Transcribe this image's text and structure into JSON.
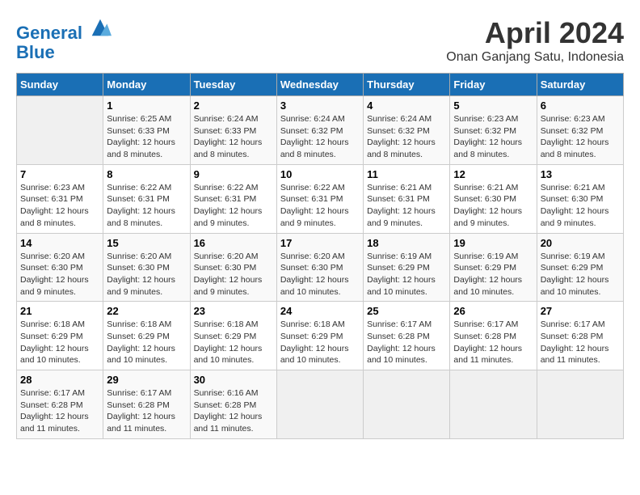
{
  "logo": {
    "line1": "General",
    "line2": "Blue"
  },
  "title": "April 2024",
  "subtitle": "Onan Ganjang Satu, Indonesia",
  "days_of_week": [
    "Sunday",
    "Monday",
    "Tuesday",
    "Wednesday",
    "Thursday",
    "Friday",
    "Saturday"
  ],
  "weeks": [
    [
      {
        "day": "",
        "empty": true
      },
      {
        "day": "1",
        "sunrise": "Sunrise: 6:25 AM",
        "sunset": "Sunset: 6:33 PM",
        "daylight": "Daylight: 12 hours and 8 minutes."
      },
      {
        "day": "2",
        "sunrise": "Sunrise: 6:24 AM",
        "sunset": "Sunset: 6:33 PM",
        "daylight": "Daylight: 12 hours and 8 minutes."
      },
      {
        "day": "3",
        "sunrise": "Sunrise: 6:24 AM",
        "sunset": "Sunset: 6:32 PM",
        "daylight": "Daylight: 12 hours and 8 minutes."
      },
      {
        "day": "4",
        "sunrise": "Sunrise: 6:24 AM",
        "sunset": "Sunset: 6:32 PM",
        "daylight": "Daylight: 12 hours and 8 minutes."
      },
      {
        "day": "5",
        "sunrise": "Sunrise: 6:23 AM",
        "sunset": "Sunset: 6:32 PM",
        "daylight": "Daylight: 12 hours and 8 minutes."
      },
      {
        "day": "6",
        "sunrise": "Sunrise: 6:23 AM",
        "sunset": "Sunset: 6:32 PM",
        "daylight": "Daylight: 12 hours and 8 minutes."
      }
    ],
    [
      {
        "day": "7",
        "sunrise": "Sunrise: 6:23 AM",
        "sunset": "Sunset: 6:31 PM",
        "daylight": "Daylight: 12 hours and 8 minutes."
      },
      {
        "day": "8",
        "sunrise": "Sunrise: 6:22 AM",
        "sunset": "Sunset: 6:31 PM",
        "daylight": "Daylight: 12 hours and 8 minutes."
      },
      {
        "day": "9",
        "sunrise": "Sunrise: 6:22 AM",
        "sunset": "Sunset: 6:31 PM",
        "daylight": "Daylight: 12 hours and 9 minutes."
      },
      {
        "day": "10",
        "sunrise": "Sunrise: 6:22 AM",
        "sunset": "Sunset: 6:31 PM",
        "daylight": "Daylight: 12 hours and 9 minutes."
      },
      {
        "day": "11",
        "sunrise": "Sunrise: 6:21 AM",
        "sunset": "Sunset: 6:31 PM",
        "daylight": "Daylight: 12 hours and 9 minutes."
      },
      {
        "day": "12",
        "sunrise": "Sunrise: 6:21 AM",
        "sunset": "Sunset: 6:30 PM",
        "daylight": "Daylight: 12 hours and 9 minutes."
      },
      {
        "day": "13",
        "sunrise": "Sunrise: 6:21 AM",
        "sunset": "Sunset: 6:30 PM",
        "daylight": "Daylight: 12 hours and 9 minutes."
      }
    ],
    [
      {
        "day": "14",
        "sunrise": "Sunrise: 6:20 AM",
        "sunset": "Sunset: 6:30 PM",
        "daylight": "Daylight: 12 hours and 9 minutes."
      },
      {
        "day": "15",
        "sunrise": "Sunrise: 6:20 AM",
        "sunset": "Sunset: 6:30 PM",
        "daylight": "Daylight: 12 hours and 9 minutes."
      },
      {
        "day": "16",
        "sunrise": "Sunrise: 6:20 AM",
        "sunset": "Sunset: 6:30 PM",
        "daylight": "Daylight: 12 hours and 9 minutes."
      },
      {
        "day": "17",
        "sunrise": "Sunrise: 6:20 AM",
        "sunset": "Sunset: 6:30 PM",
        "daylight": "Daylight: 12 hours and 10 minutes."
      },
      {
        "day": "18",
        "sunrise": "Sunrise: 6:19 AM",
        "sunset": "Sunset: 6:29 PM",
        "daylight": "Daylight: 12 hours and 10 minutes."
      },
      {
        "day": "19",
        "sunrise": "Sunrise: 6:19 AM",
        "sunset": "Sunset: 6:29 PM",
        "daylight": "Daylight: 12 hours and 10 minutes."
      },
      {
        "day": "20",
        "sunrise": "Sunrise: 6:19 AM",
        "sunset": "Sunset: 6:29 PM",
        "daylight": "Daylight: 12 hours and 10 minutes."
      }
    ],
    [
      {
        "day": "21",
        "sunrise": "Sunrise: 6:18 AM",
        "sunset": "Sunset: 6:29 PM",
        "daylight": "Daylight: 12 hours and 10 minutes."
      },
      {
        "day": "22",
        "sunrise": "Sunrise: 6:18 AM",
        "sunset": "Sunset: 6:29 PM",
        "daylight": "Daylight: 12 hours and 10 minutes."
      },
      {
        "day": "23",
        "sunrise": "Sunrise: 6:18 AM",
        "sunset": "Sunset: 6:29 PM",
        "daylight": "Daylight: 12 hours and 10 minutes."
      },
      {
        "day": "24",
        "sunrise": "Sunrise: 6:18 AM",
        "sunset": "Sunset: 6:29 PM",
        "daylight": "Daylight: 12 hours and 10 minutes."
      },
      {
        "day": "25",
        "sunrise": "Sunrise: 6:17 AM",
        "sunset": "Sunset: 6:28 PM",
        "daylight": "Daylight: 12 hours and 10 minutes."
      },
      {
        "day": "26",
        "sunrise": "Sunrise: 6:17 AM",
        "sunset": "Sunset: 6:28 PM",
        "daylight": "Daylight: 12 hours and 11 minutes."
      },
      {
        "day": "27",
        "sunrise": "Sunrise: 6:17 AM",
        "sunset": "Sunset: 6:28 PM",
        "daylight": "Daylight: 12 hours and 11 minutes."
      }
    ],
    [
      {
        "day": "28",
        "sunrise": "Sunrise: 6:17 AM",
        "sunset": "Sunset: 6:28 PM",
        "daylight": "Daylight: 12 hours and 11 minutes."
      },
      {
        "day": "29",
        "sunrise": "Sunrise: 6:17 AM",
        "sunset": "Sunset: 6:28 PM",
        "daylight": "Daylight: 12 hours and 11 minutes."
      },
      {
        "day": "30",
        "sunrise": "Sunrise: 6:16 AM",
        "sunset": "Sunset: 6:28 PM",
        "daylight": "Daylight: 12 hours and 11 minutes."
      },
      {
        "day": "",
        "empty": true
      },
      {
        "day": "",
        "empty": true
      },
      {
        "day": "",
        "empty": true
      },
      {
        "day": "",
        "empty": true
      }
    ]
  ]
}
